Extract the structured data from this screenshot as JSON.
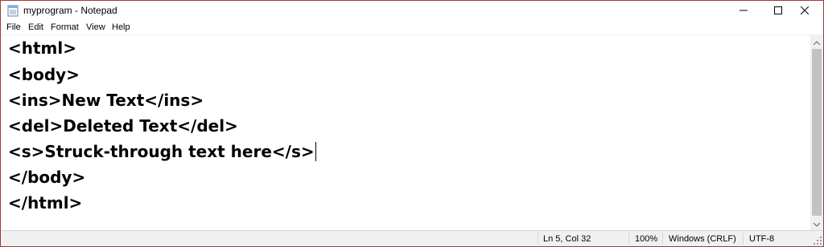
{
  "window": {
    "title": "myprogram - Notepad",
    "accent_color": "#a23a3a",
    "app_icon": "notepad-icon"
  },
  "titlebar_buttons": {
    "minimize_icon": "minimize-icon",
    "maximize_icon": "maximize-icon",
    "close_icon": "close-icon"
  },
  "menu": {
    "file": "File",
    "edit": "Edit",
    "format": "Format",
    "view": "View",
    "help": "Help"
  },
  "editor": {
    "lines": [
      "<html>",
      "<body>",
      "<ins>New Text</ins>",
      "<del>Deleted Text</del>",
      "<s>Struck-through text here</s>",
      "</body>",
      "</html>"
    ],
    "caret_line": 5
  },
  "statusbar": {
    "position": "Ln 5, Col 32",
    "zoom": "100%",
    "line_ending": "Windows (CRLF)",
    "encoding": "UTF-8"
  }
}
